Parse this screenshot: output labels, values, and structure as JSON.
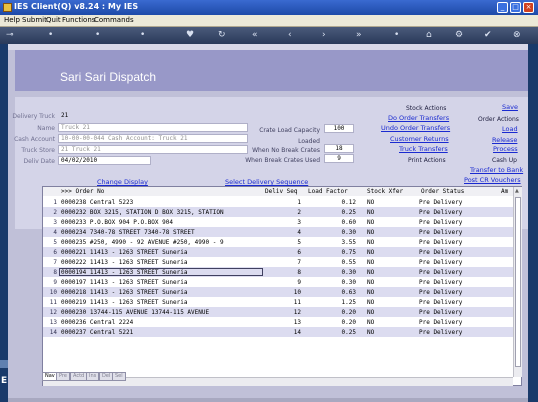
{
  "window": {
    "title": "IES Client(Q) v8.24 : My IES"
  },
  "menu": [
    "Help",
    "Submit",
    "Quit",
    "Functions",
    "Commands"
  ],
  "header": {
    "title": "Sari Sari Dispatch"
  },
  "form": {
    "delivery_truck_label": "Delivery Truck",
    "delivery_truck": "21",
    "name_label": "Name",
    "name": "Truck 21",
    "cash_account_label": "Cash Account",
    "cash_account": "10-00-00-044 Cash Account: Truck 21",
    "truck_store_label": "Truck Store",
    "truck_store": "21 Truck 21",
    "deliv_date_label": "Deliv Date",
    "deliv_date": "04/02/2010",
    "crate_load_capacity_label": "Crate Load Capacity",
    "crate_load_capacity": "100",
    "loaded_label": "Loaded",
    "when_no_break_crates_label": "When No Break Crates",
    "when_no_break_crates": "18",
    "when_break_crates_used_label": "When Break Crates Used",
    "when_break_crates_used": "9"
  },
  "actions": {
    "stock_actions_label": "Stock Actions",
    "do_order_transfers": "Do Order Transfers",
    "undo_order_transfers": "Undo Order Transfers",
    "customer_returns": "Customer Returns",
    "truck_transfers": "Truck Transfers",
    "print_actions_label": "Print Actions",
    "save": "Save",
    "order_actions_label": "Order Actions",
    "load": "Load",
    "release": "Release",
    "process": "Process",
    "cash_up_label": "Cash Up",
    "transfer_to_bank": "Transfer to Bank",
    "post_cr_vouchers": "Post CR Vouchers"
  },
  "links": {
    "change_display": "Change Display",
    "select_delivery_sequence": "Select Delivery Sequence"
  },
  "table": {
    "columns": [
      ">>> Order No",
      "Deliv Seq",
      "Load Factor",
      "Stock Xfer",
      "Order Status",
      "Am"
    ],
    "rows": [
      {
        "n": "1",
        "order": "0000238 Central 5223",
        "seq": "1",
        "load": "0.12",
        "xfer": "NO",
        "status": "Pre Delivery"
      },
      {
        "n": "2",
        "order": "0000232 BOX 3215, STATION D BOX 3215, STATION",
        "seq": "2",
        "load": "0.25",
        "xfer": "NO",
        "status": "Pre Delivery"
      },
      {
        "n": "3",
        "order": "0000233 P.O.BOX 904 P.O.BOX 904",
        "seq": "3",
        "load": "0.60",
        "xfer": "NO",
        "status": "Pre Delivery"
      },
      {
        "n": "4",
        "order": "0000234 7340-78 STREET 7340-78 STREET",
        "seq": "4",
        "load": "0.30",
        "xfer": "NO",
        "status": "Pre Delivery"
      },
      {
        "n": "5",
        "order": "0000235 #250, 4990 - 92 AVENUE #250, 4990 - 9",
        "seq": "5",
        "load": "3.55",
        "xfer": "NO",
        "status": "Pre Delivery"
      },
      {
        "n": "6",
        "order": "0000221 11413 - 1263 STREET Suneria",
        "seq": "6",
        "load": "0.75",
        "xfer": "NO",
        "status": "Pre Delivery"
      },
      {
        "n": "7",
        "order": "0000222 11413 - 1263 STREET Suneria",
        "seq": "7",
        "load": "0.55",
        "xfer": "NO",
        "status": "Pre Delivery"
      },
      {
        "n": "8",
        "order": "0000194 11413 - 1263 STREET Suneria",
        "seq": "8",
        "load": "0.30",
        "xfer": "NO",
        "status": "Pre Delivery"
      },
      {
        "n": "9",
        "order": "0000197 11413 - 1263 STREET Suneria",
        "seq": "9",
        "load": "0.30",
        "xfer": "NO",
        "status": "Pre Delivery"
      },
      {
        "n": "10",
        "order": "0000218 11413 - 1263 STREET Suneria",
        "seq": "10",
        "load": "0.63",
        "xfer": "NO",
        "status": "Pre Delivery"
      },
      {
        "n": "11",
        "order": "0000219 11413 - 1263 STREET Suneria",
        "seq": "11",
        "load": "1.25",
        "xfer": "NO",
        "status": "Pre Delivery"
      },
      {
        "n": "12",
        "order": "0000230 13744-115 AVENUE 13744-115 AVENUE",
        "seq": "12",
        "load": "0.20",
        "xfer": "NO",
        "status": "Pre Delivery"
      },
      {
        "n": "13",
        "order": "0000236 Central 2224",
        "seq": "13",
        "load": "0.20",
        "xfer": "NO",
        "status": "Pre Delivery"
      },
      {
        "n": "14",
        "order": "0000237 Central 5221",
        "seq": "14",
        "load": "0.25",
        "xfer": "NO",
        "status": "Pre Delivery"
      }
    ]
  },
  "tabs": [
    "Nav",
    "Pre",
    "Actd",
    "Ins",
    "Del",
    "Sel"
  ]
}
